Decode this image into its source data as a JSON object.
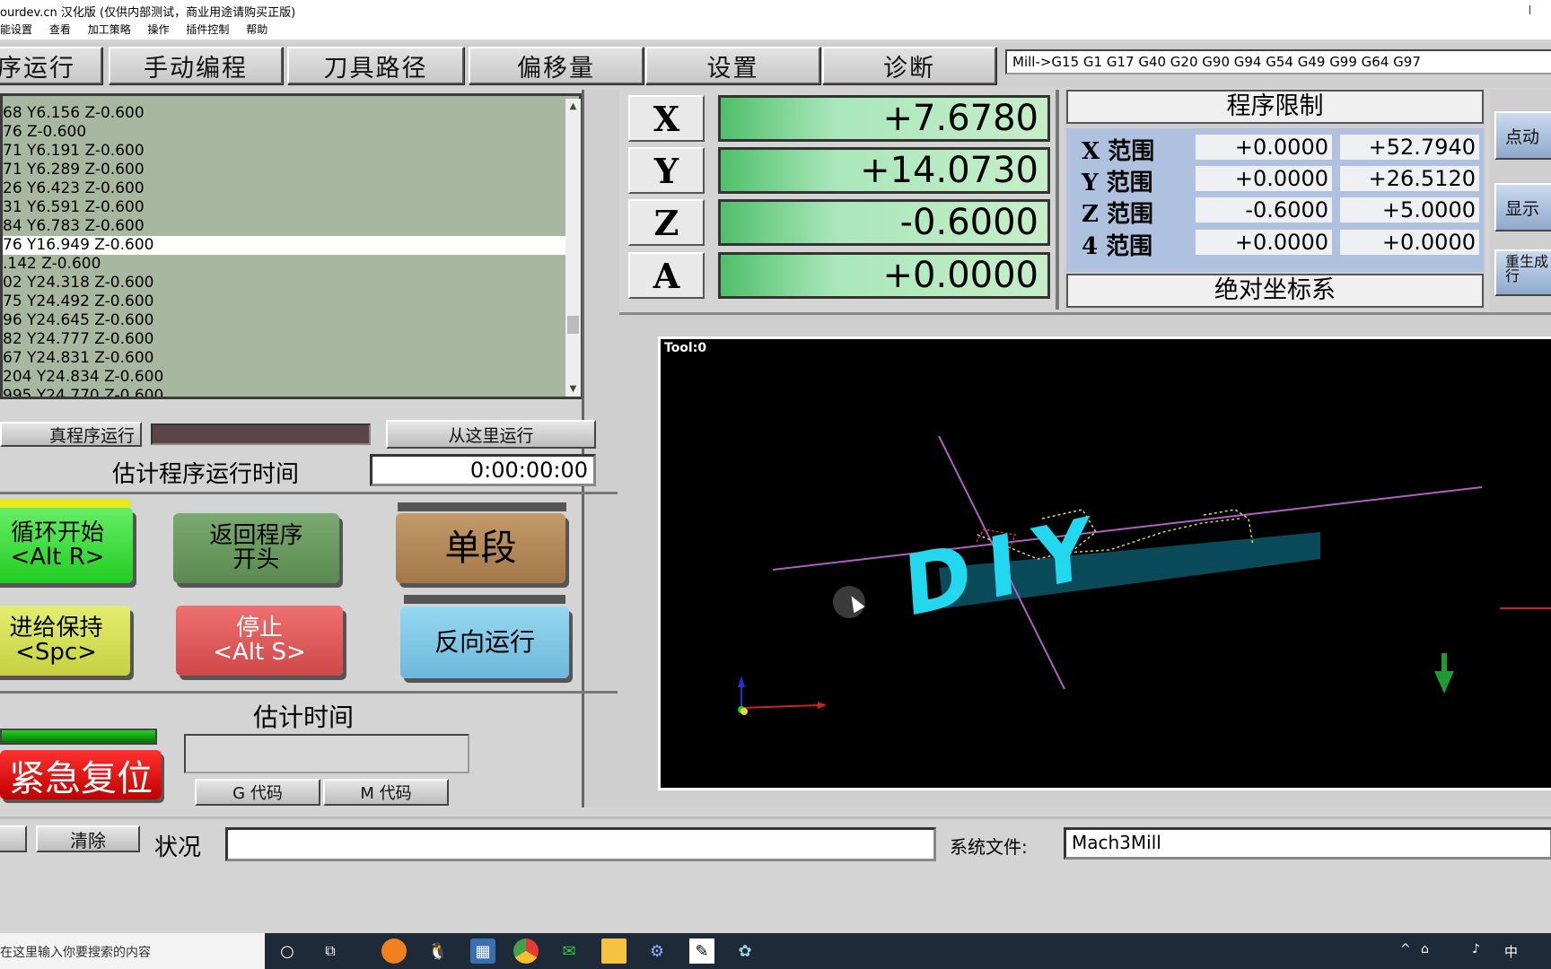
{
  "window": {
    "title": "ourdev.cn 汉化版 (仅供内部测试，商业用途请购买正版)"
  },
  "menu": [
    "能设置",
    "查看",
    "加工策略",
    "操作",
    "插件控制",
    "帮助"
  ],
  "tabs": [
    "序运行",
    "手动编程",
    "刀具路径",
    "偏移量",
    "设置",
    "诊断"
  ],
  "gcode_state": "Mill->G15  G1 G17 G40 G20 G90 G94 G54 G49 G99 G64 G97",
  "program_lines": [
    "68 Y6.156 Z-0.600",
    "76  Z-0.600",
    "71 Y6.191 Z-0.600",
    "71 Y6.289 Z-0.600",
    "26 Y6.423 Z-0.600",
    "31 Y6.591 Z-0.600",
    "84 Y6.783 Z-0.600",
    "76 Y16.949 Z-0.600",
    ".142 Z-0.600",
    "02 Y24.318 Z-0.600",
    "75 Y24.492 Z-0.600",
    "96 Y24.645 Z-0.600",
    "82 Y24.777 Z-0.600",
    "67 Y24.831 Z-0.600",
    "204 Y24.834 Z-0.600",
    "995 Y24.770 Z-0.600"
  ],
  "selected_line_index": 7,
  "run_controls": {
    "sim_run": "真程序运行",
    "run_from_here": "从这里运行",
    "estimate_label": "估计程序运行时间",
    "estimate_value": "0:00:00:00"
  },
  "buttons": {
    "cycle_start": "循环开始\n<Alt R>",
    "rewind": "返回程序\n开头",
    "single_block": "单段",
    "feed_hold": "进给保持\n<Spc>",
    "stop": "停止\n<Alt S>",
    "reverse_run": "反向运行",
    "estimated_time": "估计时间",
    "estop_reset": "紧急复位",
    "g_codes": "G 代码",
    "m_codes": "M 代码"
  },
  "dro": [
    {
      "axis": "X",
      "value": "+7.6780"
    },
    {
      "axis": "Y",
      "value": "+14.0730"
    },
    {
      "axis": "Z",
      "value": "-0.6000"
    },
    {
      "axis": "A",
      "value": "+0.0000"
    }
  ],
  "limits": {
    "title": "程序限制",
    "rows": [
      {
        "label": "X 范围",
        "min": "+0.0000",
        "max": "+52.7940"
      },
      {
        "label": "Y 范围",
        "min": "+0.0000",
        "max": "+26.5120"
      },
      {
        "label": "Z 范围",
        "min": "-0.6000",
        "max": "+5.0000"
      },
      {
        "label": "4 范围",
        "min": "+0.0000",
        "max": "+0.0000"
      }
    ],
    "coord_system": "绝对坐标系"
  },
  "side_buttons": [
    "点动",
    "显示",
    "重生成\n行"
  ],
  "viewer": {
    "tool_label": "Tool:0",
    "engraving_text": "DIY"
  },
  "status": {
    "clear": "清除",
    "status_label": "状况",
    "sysfile_label": "系统文件:",
    "sysfile_value": "Mach3Mill"
  },
  "taskbar": {
    "search_placeholder": "在这里输入你要搜索的内容",
    "ime": "中"
  },
  "colors": {
    "list_bg": "#a8b8a0",
    "dro_bg": "#4fbf6a",
    "limits_bg": "#aec2df",
    "cycle_start": "#44dd44",
    "feed_hold": "#d8e455",
    "stop": "#e06060",
    "reverse": "#80c8e8",
    "single_block": "#b28a60",
    "rewind": "#6a9a60",
    "estop": "#e00000"
  }
}
